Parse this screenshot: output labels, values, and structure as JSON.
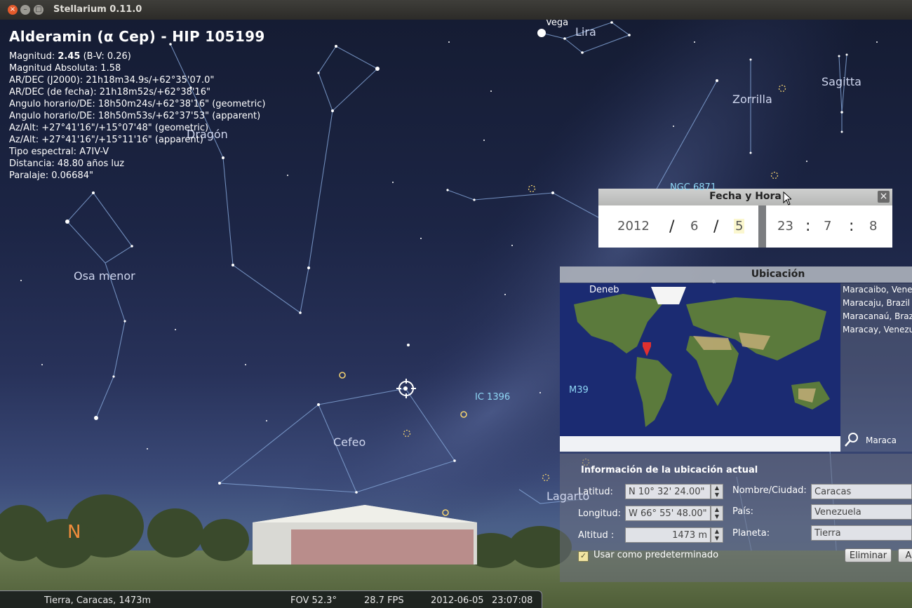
{
  "window": {
    "title": "Stellarium 0.11.0",
    "buttons": {
      "close": "×",
      "minimize": "–",
      "maximize": "□"
    }
  },
  "object_info": {
    "title": "Alderamin (α Cep) - HIP 105199",
    "mag_prefix": "Magnitud: ",
    "mag_value": "2.45",
    "mag_suffix": " (B-V: 0.26)",
    "lines": [
      "Magnitud Absoluta: 1.58",
      "AR/DEC (J2000): 21h18m34.9s/+62°35'07.0\"",
      "AR/DEC (de fecha): 21h18m52s/+62°38'16\"",
      "Angulo horario/DE: 18h50m24s/+62°38'16\" (geometric)",
      "Angulo horario/DE: 18h50m53s/+62°37'53\" (apparent)",
      "Az/Alt: +27°41'16\"/+15°07'48\" (geometric)",
      "Az/Alt: +27°41'16\"/+15°11'16\" (apparent)",
      "Tipo espectral: A7IV-V",
      "Distancia: 48.80 años luz",
      "Paralaje: 0.06684\""
    ]
  },
  "sky_labels": {
    "vega": "Vega",
    "lira": "Lira",
    "sagitta": "Sagitta",
    "zorrilla": "Zorrilla",
    "dragon": "Dragón",
    "osa_menor": "Osa menor",
    "cefeo": "Cefeo",
    "lagarto": "Lagarto",
    "deneb": "Deneb",
    "ngc6871": "NGC 6871",
    "ic1396": "IC 1396",
    "m39": "M39",
    "cardinal_north": "N"
  },
  "datetime_dialog": {
    "title": "Fecha y Hora",
    "close": "×",
    "year": "2012",
    "month": "6",
    "day": "5",
    "hour": "23",
    "minute": "7",
    "second": "8",
    "date_sep": "/",
    "time_sep": ":"
  },
  "location_dialog": {
    "title": "Ubicación",
    "cities": [
      "Maracaibo, Vene",
      "Maracaju, Brazil",
      "Maracanaú, Braz",
      "Maracay, Venezu"
    ],
    "search_text": "Maraca",
    "section_title": "Información de la ubicación actual",
    "latitude_label": "Latitud:",
    "latitude_value": "N 10° 32' 24.00\"",
    "longitude_label": "Longitud:",
    "longitude_value": "W 66° 55' 48.00\"",
    "altitude_label": "Altitud :",
    "altitude_value": "1473 m",
    "name_label": "Nombre/Ciudad:",
    "name_value": "Caracas",
    "country_label": "País:",
    "country_value": "Venezuela",
    "planet_label": "Planeta:",
    "planet_value": "Tierra",
    "default_checkbox_label": "Usar como predeterminado",
    "default_checked": true,
    "delete_button": "Eliminar",
    "add_button": "A"
  },
  "status_bar": {
    "location": "Tierra, Caracas, 1473m",
    "fov": "FOV 52.3°",
    "fps": "28.7 FPS",
    "date": "2012-06-05",
    "time": "23:07:08"
  },
  "colors": {
    "constellation_line": "#7f9fd0",
    "cardinal_point": "#f08c3c",
    "dso_label": "#8fd7f5",
    "marker_red": "#e03030"
  }
}
